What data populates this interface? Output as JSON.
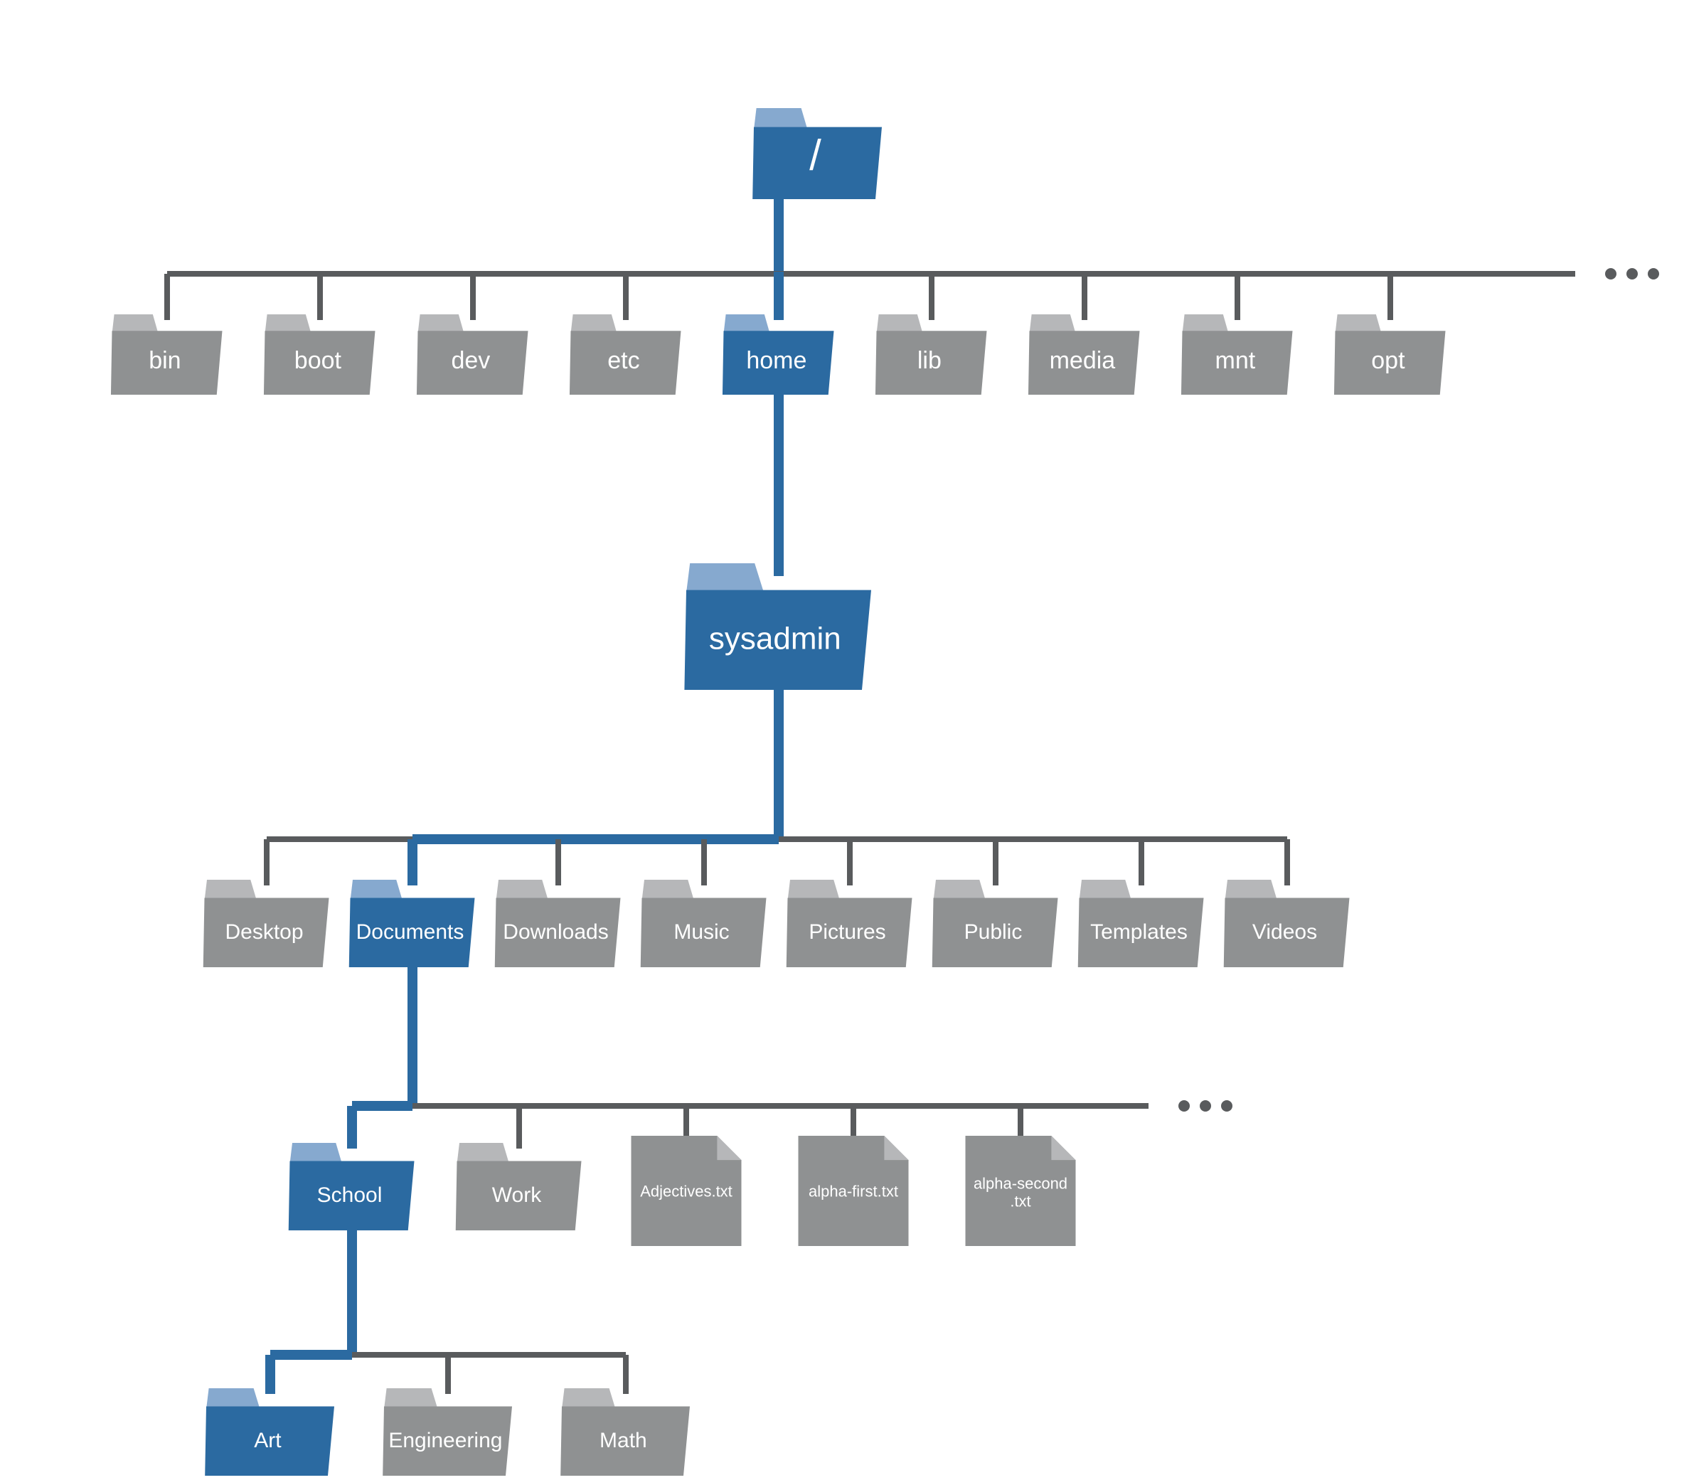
{
  "colors": {
    "gray": "#8f9192",
    "gray_light": "#b6b7b9",
    "blue": "#2b6aa1",
    "blue_light": "#86a9cf",
    "line_gray": "#595b5d",
    "line_blue": "#2b6aa1",
    "text": "#ffffff",
    "ellipsis": "#595b5d"
  },
  "ellipsis": "• • •",
  "tree": {
    "name": "root",
    "label": "/",
    "type": "folder-root",
    "highlighted": true,
    "children": [
      {
        "name": "bin",
        "label": "bin",
        "type": "folder",
        "highlighted": false
      },
      {
        "name": "boot",
        "label": "boot",
        "type": "folder",
        "highlighted": false
      },
      {
        "name": "dev",
        "label": "dev",
        "type": "folder",
        "highlighted": false
      },
      {
        "name": "etc",
        "label": "etc",
        "type": "folder",
        "highlighted": false
      },
      {
        "name": "home",
        "label": "home",
        "type": "folder",
        "highlighted": true,
        "children": [
          {
            "name": "sysadmin",
            "label": "sysadmin",
            "type": "folder-big",
            "highlighted": true,
            "children": [
              {
                "name": "desktop",
                "label": "Desktop",
                "type": "folder",
                "highlighted": false
              },
              {
                "name": "documents",
                "label": "Documents",
                "type": "folder",
                "highlighted": true,
                "children": [
                  {
                    "name": "school",
                    "label": "School",
                    "type": "folder",
                    "highlighted": true,
                    "children": [
                      {
                        "name": "art",
                        "label": "Art",
                        "type": "folder",
                        "highlighted": true
                      },
                      {
                        "name": "engineering",
                        "label": "Engineering",
                        "type": "folder",
                        "highlighted": false
                      },
                      {
                        "name": "math",
                        "label": "Math",
                        "type": "folder",
                        "highlighted": false
                      }
                    ]
                  },
                  {
                    "name": "work",
                    "label": "Work",
                    "type": "folder",
                    "highlighted": false
                  },
                  {
                    "name": "adjectives",
                    "label": "Adjectives.txt",
                    "type": "file",
                    "highlighted": false
                  },
                  {
                    "name": "alpha-first",
                    "label": "alpha-first.txt",
                    "type": "file",
                    "highlighted": false
                  },
                  {
                    "name": "alpha-second",
                    "label": "alpha-second\n.txt",
                    "type": "file",
                    "highlighted": false
                  }
                ],
                "ellipsis_after": true
              },
              {
                "name": "downloads",
                "label": "Downloads",
                "type": "folder",
                "highlighted": false
              },
              {
                "name": "music",
                "label": "Music",
                "type": "folder",
                "highlighted": false
              },
              {
                "name": "pictures",
                "label": "Pictures",
                "type": "folder",
                "highlighted": false
              },
              {
                "name": "public",
                "label": "Public",
                "type": "folder",
                "highlighted": false
              },
              {
                "name": "templates",
                "label": "Templates",
                "type": "folder",
                "highlighted": false
              },
              {
                "name": "videos",
                "label": "Videos",
                "type": "folder",
                "highlighted": false
              }
            ]
          }
        ]
      },
      {
        "name": "lib",
        "label": "lib",
        "type": "folder",
        "highlighted": false
      },
      {
        "name": "media",
        "label": "media",
        "type": "folder",
        "highlighted": false
      },
      {
        "name": "mnt",
        "label": "mnt",
        "type": "folder",
        "highlighted": false
      },
      {
        "name": "opt",
        "label": "opt",
        "type": "folder",
        "highlighted": false
      }
    ],
    "ellipsis_after": true
  }
}
